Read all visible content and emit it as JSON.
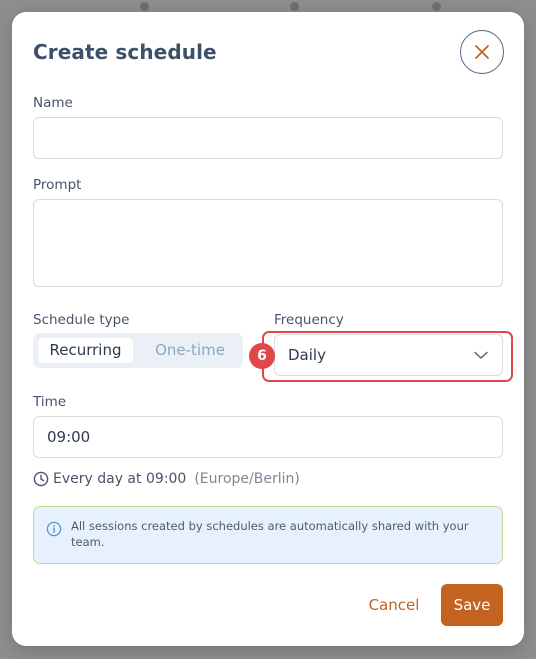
{
  "dialog": {
    "title": "Create schedule"
  },
  "fields": {
    "name": {
      "label": "Name",
      "value": ""
    },
    "prompt": {
      "label": "Prompt",
      "value": ""
    },
    "schedule_type": {
      "label": "Schedule type",
      "options": [
        "Recurring",
        "One-time"
      ],
      "selected": "Recurring"
    },
    "frequency": {
      "label": "Frequency",
      "value": "Daily"
    },
    "time": {
      "label": "Time",
      "value": "09:00"
    }
  },
  "summary": {
    "text": "Every day at 09:00",
    "timezone": "(Europe/Berlin)"
  },
  "info": {
    "text": "All sessions created by schedules are automatically shared with your team."
  },
  "annotation": {
    "badge_number": "6",
    "color": "#e0474a"
  },
  "actions": {
    "cancel_label": "Cancel",
    "save_label": "Save"
  },
  "colors": {
    "accent": "#c4621f",
    "title": "#3d5069",
    "info_bg": "#e6f1fd"
  },
  "icons": {
    "close": "close-icon",
    "chevron": "chevron-down-icon",
    "clock": "clock-icon",
    "info": "info-icon"
  }
}
